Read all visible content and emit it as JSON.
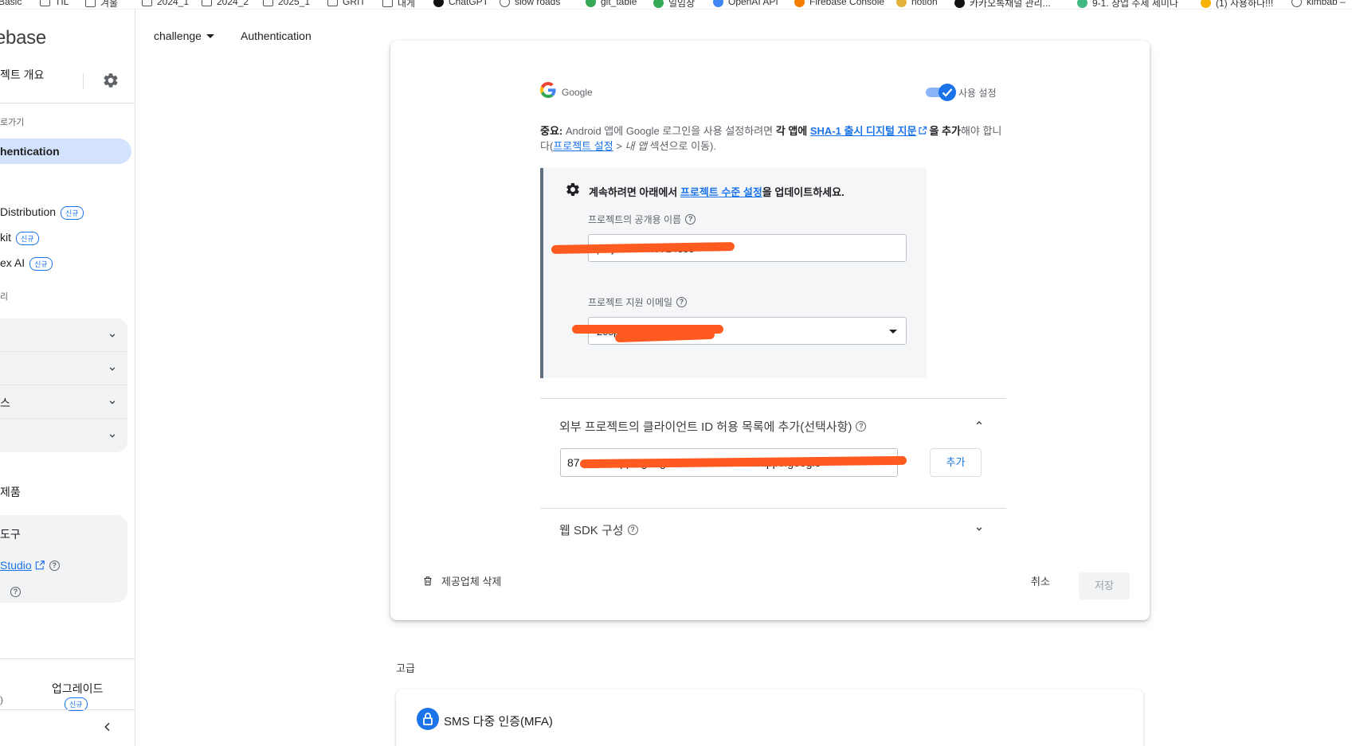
{
  "bookmarks": [
    {
      "label": "Basic",
      "icon": "none"
    },
    {
      "label": "TIL",
      "icon": "folder-icon"
    },
    {
      "label": "겨울",
      "icon": "folder-icon"
    },
    {
      "label": "2024_1",
      "icon": "folder-icon"
    },
    {
      "label": "2024_2",
      "icon": "folder-icon"
    },
    {
      "label": "2025_1",
      "icon": "folder-icon"
    },
    {
      "label": "GRIT",
      "icon": "folder-icon"
    },
    {
      "label": "대게",
      "icon": "folder-icon"
    },
    {
      "label": "ChatGPT",
      "icon": "chatgpt-icon"
    },
    {
      "label": "slow roads",
      "icon": "slowroads-icon"
    },
    {
      "label": "git_table",
      "icon": "sheet-icon"
    },
    {
      "label": "일임장",
      "icon": "sheet-icon"
    },
    {
      "label": "OpenAI API",
      "icon": "openai-icon"
    },
    {
      "label": "Firebase Console",
      "icon": "firebase-icon"
    },
    {
      "label": "notion",
      "icon": "notion-icon"
    },
    {
      "label": "카카오톡채널 관리...",
      "icon": "kakao-icon"
    },
    {
      "label": "9-1. 창업 주제 세미나",
      "icon": "v-icon"
    },
    {
      "label": "(1) 사용하나!!!",
      "icon": "emoji-icon"
    },
    {
      "label": "kimbab –",
      "icon": "gear-icon"
    }
  ],
  "sidebar": {
    "brand": "ebase",
    "overview": "젝트 개요",
    "shortcuts_label": "로가기",
    "active_item": "hentication",
    "items": [
      {
        "label": "Distribution",
        "badge": "신규"
      },
      {
        "label": "kit",
        "badge": "신규"
      },
      {
        "label": "ex AI",
        "badge": "신규"
      }
    ],
    "category_label": "리",
    "groups": [
      {
        "label": ""
      },
      {
        "label": ""
      },
      {
        "label": "스"
      },
      {
        "label": ""
      }
    ],
    "products_label": "제품",
    "tools": {
      "title": "도구",
      "studio_link": "Studio"
    },
    "footer": {
      "left_text": ")",
      "upgrade_label": "업그레이드",
      "upgrade_badge": "신규"
    }
  },
  "topbar": {
    "project": "challenge",
    "page": "Authentication"
  },
  "provider": {
    "name": "Google",
    "toggle_label": "사용 설정",
    "enabled": true
  },
  "notice": {
    "prefix": "중요:",
    "text1": " Android 앱에 Google 로그인을 사용 설정하려면 ",
    "bold1": "각 앱에",
    "link1": "SHA-1 출시 디지털 지문",
    "bold2": "을 추가",
    "text2": "해야 합니다(",
    "link2": "프로젝트 설정",
    "text3": " > ",
    "italic1": "내 앱",
    "text4": " 섹션으로 이동)."
  },
  "project_settings": {
    "prefix": "계속하려면 아래에서 ",
    "link": "프로젝트 수준 설정",
    "suffix": "을 업데이트하세요.",
    "public_name_label": "프로젝트의 공개용 이름",
    "public_name_value": "project-87449724389",
    "support_email_label": "프로젝트 지원 이메일",
    "support_email_value": "20sp..."
  },
  "client_ids": {
    "title": "외부 프로젝트의 클라이언트 ID 허용 목록에 추가(선택사항)",
    "value": "87...........apps.googleusercontent.com.apps.google",
    "add_label": "추가"
  },
  "web_sdk": {
    "title": "웹 SDK 구성"
  },
  "actions": {
    "delete_label": "제공업체 삭제",
    "cancel_label": "취소",
    "save_label": "저장"
  },
  "advanced": {
    "label": "고급",
    "mfa_title": "SMS 다중 인증(MFA)"
  },
  "colors": {
    "accent": "#1a73e8",
    "active_bg": "#d3e3fd",
    "redaction": "#ff5a1f"
  }
}
